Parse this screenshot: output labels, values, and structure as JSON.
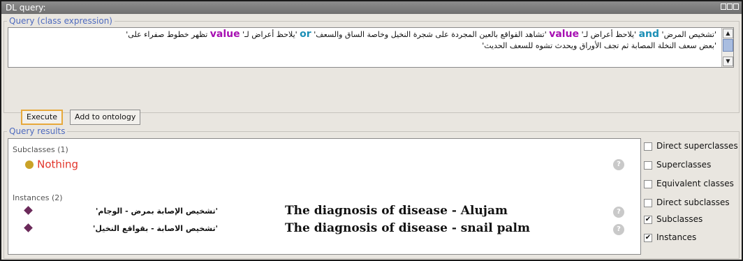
{
  "window": {
    "title": "DL query:"
  },
  "query": {
    "legend": "Query (class expression)",
    "seg1": "تظهر خطوط صفراء على'",
    "kw_value": "value",
    "seg2": "'يلاحظ أعراض لـ'",
    "kw_or": "or",
    "seg3": "'تشاهد القواقع بالعين المجردة على شجرة النخيل وخاصة الساق والسعف'",
    "seg4": "'يلاحظ أعراض لـ'",
    "kw_and": "and",
    "seg5": "'تشخيص المرض'",
    "line2": "'بعض سعف النخلة المصابة ثم تجف الأوراق ويحدث تشوه للسعف الحديث'",
    "execute_label": "Execute",
    "add_label": "Add to ontology"
  },
  "results": {
    "legend": "Query results",
    "subclasses_header": "Subclasses (1)",
    "nothing_label": "Nothing",
    "instances_header": "Instances (2)",
    "instances": [
      {
        "arabic": "'تشخيص الإصابة بمرض - الوجام'",
        "english": "The diagnosis of disease - Alujam"
      },
      {
        "arabic": "'تشخيص الاصابة - بقواقع النخيل'",
        "english": "The diagnosis of disease - snail palm"
      }
    ],
    "help_glyph": "?"
  },
  "options": [
    {
      "label": "Direct superclasses",
      "checked": false
    },
    {
      "label": "Superclasses",
      "checked": false
    },
    {
      "label": "Equivalent classes",
      "checked": false
    },
    {
      "label": "Direct subclasses",
      "checked": false
    },
    {
      "label": "Subclasses",
      "checked": true
    },
    {
      "label": "Instances",
      "checked": true
    }
  ],
  "colors": {
    "nothing": "#e2342a",
    "nothing_dot": "#c9a227",
    "diamond": "#6b2a5a",
    "legend": "#4f6bbf",
    "keyword_value": "#a60fb2",
    "keyword_or": "#1c8fb6"
  },
  "icons": {
    "class_dot": "circle-icon",
    "individual": "diamond-icon",
    "help": "help-icon",
    "window_controls": "window-control-icons"
  }
}
